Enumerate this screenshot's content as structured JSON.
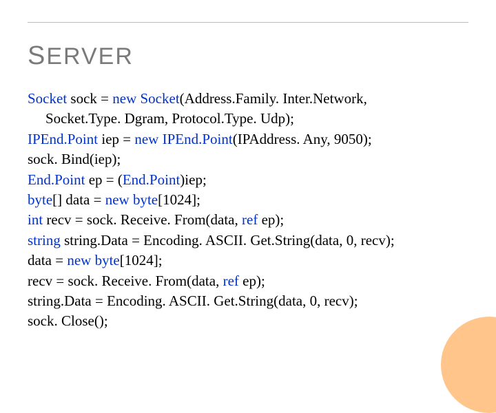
{
  "title": {
    "big": "S",
    "rest": "ERVER"
  },
  "code": {
    "l1a": "Socket",
    "l1b": " sock = ",
    "l1c": "new",
    "l1d": " ",
    "l1e": "Socket",
    "l1f": "(Address.Family. Inter.Network,",
    "l2": "Socket.Type. Dgram, Protocol.Type. Udp);",
    "l3a": "IPEnd.Point",
    "l3b": " iep = ",
    "l3c": "new",
    "l3d": " ",
    "l3e": "IPEnd.Point",
    "l3f": "(IPAddress. Any, 9050);",
    "l4": "sock. Bind(iep);",
    "l5a": "End.Point",
    "l5b": " ep = (",
    "l5c": "End.Point",
    "l5d": ")iep;",
    "l6a": "byte",
    "l6b": "[] data = ",
    "l6c": "new",
    "l6d": " ",
    "l6e": "byte",
    "l6f": "[1024];",
    "l7a": "int",
    "l7b": " recv = sock. Receive. From(data, ",
    "l7c": "ref",
    "l7d": " ep);",
    "l8a": "string",
    "l8b": " string.Data = Encoding. ASCII. Get.String(data, 0, recv);",
    "l9a": "data = ",
    "l9b": "new",
    "l9c": " ",
    "l9d": "byte",
    "l9e": "[1024];",
    "l10a": "recv = sock. Receive. From(data, ",
    "l10b": "ref",
    "l10c": " ep);",
    "l11": "string.Data = Encoding. ASCII. Get.String(data, 0, recv);",
    "l12": "sock. Close();"
  }
}
